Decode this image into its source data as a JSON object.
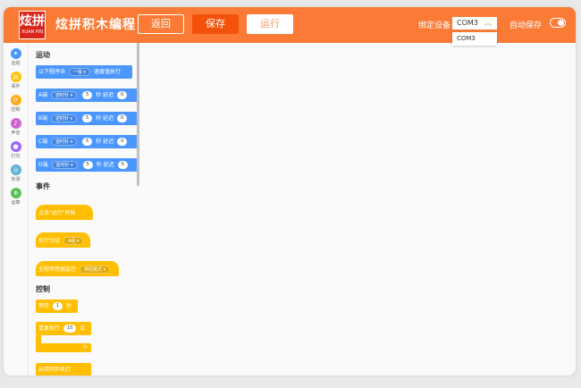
{
  "header": {
    "logo_main": "炫拼",
    "logo_sub": "XUAN PIN",
    "title": "炫拼积木编程",
    "back_label": "返回",
    "save_label": "保存",
    "run_label": "运行",
    "bind_device_label": "绑定设备",
    "port_selected": "COM3",
    "autosave_label": "自动保存",
    "autosave_on": true
  },
  "port_dropdown": {
    "options": [
      "COM3"
    ]
  },
  "sidebar": {
    "items": [
      {
        "label": "运动",
        "color": "#4c97ff",
        "icon": "run-icon"
      },
      {
        "label": "事件",
        "color": "#ffbf00",
        "icon": "event-icon"
      },
      {
        "label": "控制",
        "color": "#ffab19",
        "icon": "control-icon"
      },
      {
        "label": "声音",
        "color": "#cf63cf",
        "icon": "sound-icon"
      },
      {
        "label": "灯光",
        "color": "#9966ff",
        "icon": "light-icon"
      },
      {
        "label": "侦测",
        "color": "#5cb1d6",
        "icon": "sensor-icon"
      },
      {
        "label": "运算",
        "color": "#59c059",
        "icon": "operator-icon"
      }
    ]
  },
  "palette": {
    "motion_title": "运动",
    "motion_block1": {
      "prefix": "以下程序块",
      "dropdown": "一级",
      "suffix": "速度值执行"
    },
    "motor_blocks": [
      {
        "port": "A端",
        "dir": "逆时针",
        "speed": "5",
        "delay_label": "秒 延迟",
        "delay": "0"
      },
      {
        "port": "B端",
        "dir": "逆时针",
        "speed": "5",
        "delay_label": "秒 延迟",
        "delay": "0"
      },
      {
        "port": "C端",
        "dir": "逆时针",
        "speed": "5",
        "delay_label": "秒 延迟",
        "delay": "0"
      },
      {
        "port": "D端",
        "dir": "逆时针",
        "speed": "5",
        "delay_label": "秒 延迟",
        "delay": "0"
      }
    ],
    "event_title": "事件",
    "event_start": "点击\"运行\"开始",
    "event_branch": {
      "label": "执行分组",
      "dropdown": "A组"
    },
    "event_sensor": {
      "label": "全程传感器监控",
      "dropdown": "简短模式"
    },
    "control_title": "控制",
    "control_wait": {
      "label": "等待",
      "value": "1",
      "unit": "秒"
    },
    "control_repeat": {
      "label": "重复执行",
      "value": "10",
      "unit": "次"
    },
    "control_sync": "启用同步执行"
  },
  "colors": {
    "header": "#fb7b36",
    "save": "#f4520c",
    "motion": "#4c97ff",
    "event": "#ffbf00"
  }
}
